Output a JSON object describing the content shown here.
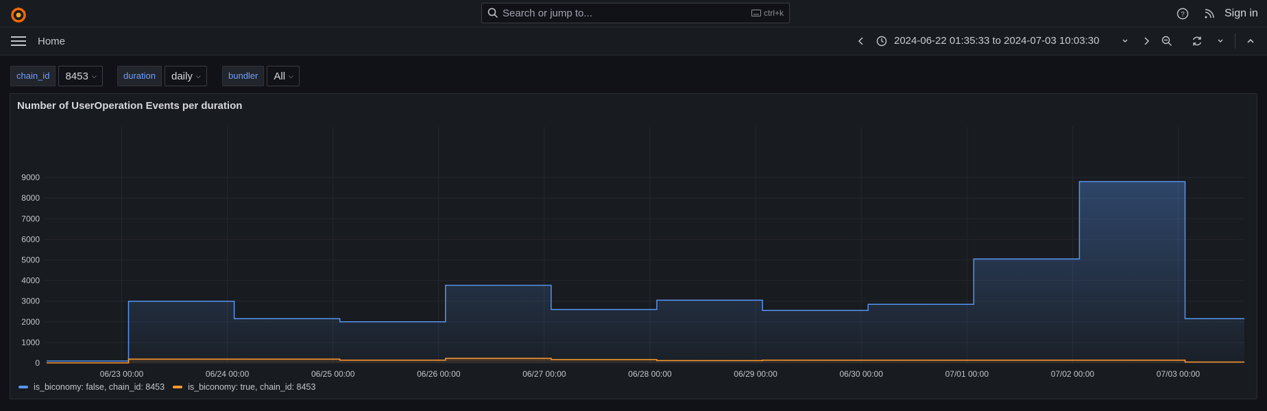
{
  "search": {
    "placeholder": "Search or jump to...",
    "shortcut": "ctrl+k"
  },
  "topbar": {
    "sign_in": "Sign in"
  },
  "nav": {
    "breadcrumb": "Home",
    "time_range": "2024-06-22 01:35:33 to 2024-07-03 10:03:30"
  },
  "variables": [
    {
      "label": "chain_id",
      "value": "8453"
    },
    {
      "label": "duration",
      "value": "daily"
    },
    {
      "label": "bundler",
      "value": "All"
    }
  ],
  "panel": {
    "title": "Number of UserOperation Events per duration"
  },
  "colors": {
    "series_false": "#5794f2",
    "series_true": "#ff9830",
    "accent": "#6e9fff"
  },
  "chart_data": {
    "type": "line",
    "step": true,
    "x": [
      "06/22 01:35:33",
      "06/23 00:00",
      "06/24 00:00",
      "06/25 00:00",
      "06/26 00:00",
      "06/27 00:00",
      "06/28 00:00",
      "06/29 00:00",
      "06/30 00:00",
      "07/01 00:00",
      "07/02 00:00",
      "07/03 00:00"
    ],
    "x_ticks": [
      "06/23 00:00",
      "06/24 00:00",
      "06/25 00:00",
      "06/26 00:00",
      "06/27 00:00",
      "06/28 00:00",
      "06/29 00:00",
      "06/30 00:00",
      "07/01 00:00",
      "07/02 00:00",
      "07/03 00:00"
    ],
    "y_ticks": [
      0,
      1000,
      2000,
      3000,
      4000,
      5000,
      6000,
      7000,
      8000,
      9000
    ],
    "ylim": [
      0,
      10000
    ],
    "series": [
      {
        "name": "is_biconomy: false, chain_id: 8453",
        "color": "#5794f2",
        "values": [
          100,
          3000,
          2150,
          2000,
          3770,
          2600,
          3050,
          2550,
          2850,
          5050,
          8800,
          2150
        ]
      },
      {
        "name": "is_biconomy: true, chain_id: 8453",
        "color": "#ff9830",
        "values": [
          10,
          190,
          190,
          140,
          230,
          170,
          120,
          140,
          140,
          140,
          140,
          50
        ]
      }
    ],
    "grid": true,
    "legend_position": "bottom-left"
  }
}
